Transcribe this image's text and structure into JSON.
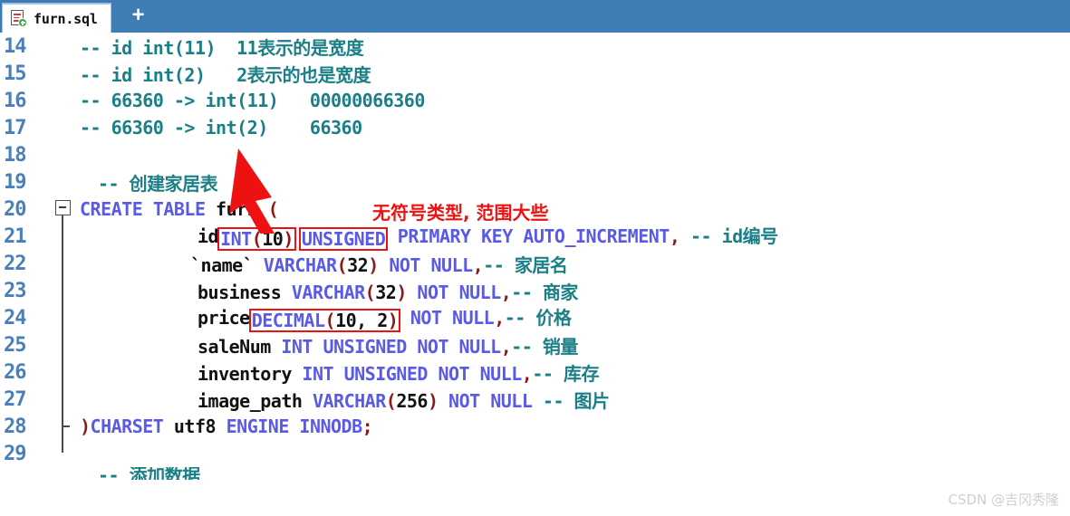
{
  "window": {
    "tab": {
      "icon": "sql-file-icon",
      "label": "furn.sql"
    },
    "new_tab_label": "+",
    "tabbar_color": "#3d7cb5"
  },
  "colors": {
    "comment": "#1a7f86",
    "keyword": "#5a5ae8",
    "identifier": "#111111",
    "punctuation": "#8b1a1a",
    "line_number": "#4a7fb8",
    "annotation": "#ee1111",
    "watermark": "#cfcfcf"
  },
  "editor": {
    "lines": [
      {
        "number": "14",
        "text": "-- id int(11)  11表示的是宽度"
      },
      {
        "number": "15",
        "text": "-- id int(2)   2表示的也是宽度"
      },
      {
        "number": "16",
        "text": "-- 66360 -> int(11)   00000066360"
      },
      {
        "number": "17",
        "text": "-- 66360 -> int(2)    66360"
      },
      {
        "number": "18",
        "text": ""
      },
      {
        "number": "19",
        "text": "-- 创建家居表"
      },
      {
        "number": "20",
        "text": "CREATE TABLE furn ("
      },
      {
        "number": "21",
        "text": "id INT(10) UNSIGNED PRIMARY KEY AUTO_INCREMENT, -- id编号"
      },
      {
        "number": "22",
        "text": "`name` VARCHAR(32) NOT NULL,-- 家居名"
      },
      {
        "number": "23",
        "text": "business VARCHAR(32) NOT NULL,-- 商家"
      },
      {
        "number": "24",
        "text": "price DECIMAL(10, 2) NOT NULL,-- 价格"
      },
      {
        "number": "25",
        "text": "saleNum INT UNSIGNED NOT NULL,-- 销量"
      },
      {
        "number": "26",
        "text": "inventory INT UNSIGNED NOT NULL,-- 库存"
      },
      {
        "number": "27",
        "text": "image_path VARCHAR(256) NOT NULL -- 图片"
      },
      {
        "number": "28",
        "text": ")CHARSET utf8 ENGINE INNODB;"
      },
      {
        "number": "29",
        "text": ""
      }
    ],
    "tokens": {
      "l14": {
        "comment": "-- id int(11)  11表示的是宽度"
      },
      "l15": {
        "comment": "-- id int(2)   2表示的也是宽度"
      },
      "l16": {
        "comment": "-- 66360 -> int(11)   00000066360"
      },
      "l17": {
        "comment": "-- 66360 -> int(2)    66360"
      },
      "l19": {
        "comment": "-- 创建家居表"
      },
      "l20": {
        "kw": "CREATE TABLE",
        "id": "furn",
        "paren": "("
      },
      "l21": {
        "id": "id",
        "type_boxed": "INT(10)",
        "type_kw": "INT",
        "type_paren_open": "(",
        "type_size": "10",
        "type_paren_close": ")",
        "unsigned_boxed": "UNSIGNED",
        "rest_kw": "PRIMARY KEY AUTO_INCREMENT",
        "comma": ",",
        "comment": "-- id编号"
      },
      "l22": {
        "id": "`name`",
        "kw": "VARCHAR",
        "paren_open": "(",
        "size": "32",
        "paren_close": ")",
        "notnull": "NOT NULL",
        "comma": ",",
        "comment": "-- 家居名"
      },
      "l23": {
        "id": "business",
        "kw": "VARCHAR",
        "paren_open": "(",
        "size": "32",
        "paren_close": ")",
        "notnull": "NOT NULL",
        "comma": ",",
        "comment": "-- 商家"
      },
      "l24": {
        "id": "price",
        "kw": "DECIMAL",
        "paren_open": "(",
        "size": "10, 2",
        "paren_close": ")",
        "notnull": "NOT NULL",
        "comma": ",",
        "comment": "-- 价格"
      },
      "l25": {
        "id": "saleNum",
        "kw": "INT UNSIGNED NOT NULL",
        "comma": ",",
        "comment": "-- 销量"
      },
      "l26": {
        "id": "inventory",
        "kw": "INT UNSIGNED NOT NULL",
        "comma": ",",
        "comment": "-- 库存"
      },
      "l27": {
        "id": "image_path",
        "kw": "VARCHAR",
        "paren_open": "(",
        "size": "256",
        "paren_close": ")",
        "notnull": "NOT NULL",
        "comment": "-- 图片"
      },
      "l28": {
        "paren": ")",
        "kw1": "CHARSET",
        "id": "utf8",
        "kw2": "ENGINE INNODB",
        "semi": ";"
      }
    }
  },
  "annotations": {
    "unsigned_note": "无符号类型, 范围大些",
    "arrow": "red-up-arrow",
    "highlight_boxes": [
      "INT(10)",
      "UNSIGNED",
      "DECIMAL(10, 2)"
    ]
  },
  "watermark": "CSDN @吉冈秀隆"
}
